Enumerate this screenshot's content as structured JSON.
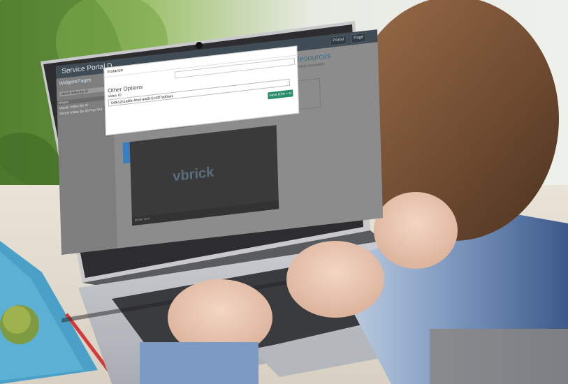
{
  "portal": {
    "title": "Service Portal D",
    "top_buttons": [
      "Portal",
      "Page"
    ],
    "tabs": [
      "Widgets",
      "Pages"
    ],
    "filter_value": "vbrick video by id",
    "list_header": "Widgets",
    "list_items": [
      "Vbrick Video By Id",
      "Vbrick Video By ID Pop Out"
    ],
    "content_heading": "Resources",
    "content_sub": "and fully accessible",
    "container_label": "Remove Component Border"
  },
  "modal": {
    "header": "Instance",
    "section_label": "Other Options",
    "video_id_label": "Video ID",
    "video_id_value": "54f61251a6fb-4bcd-a4d0-5143f7ad0ae1",
    "save_button": "Save (Ctrl + s)"
  },
  "player": {
    "brand": "vbrick",
    "time": "00:00 / 00:0"
  }
}
